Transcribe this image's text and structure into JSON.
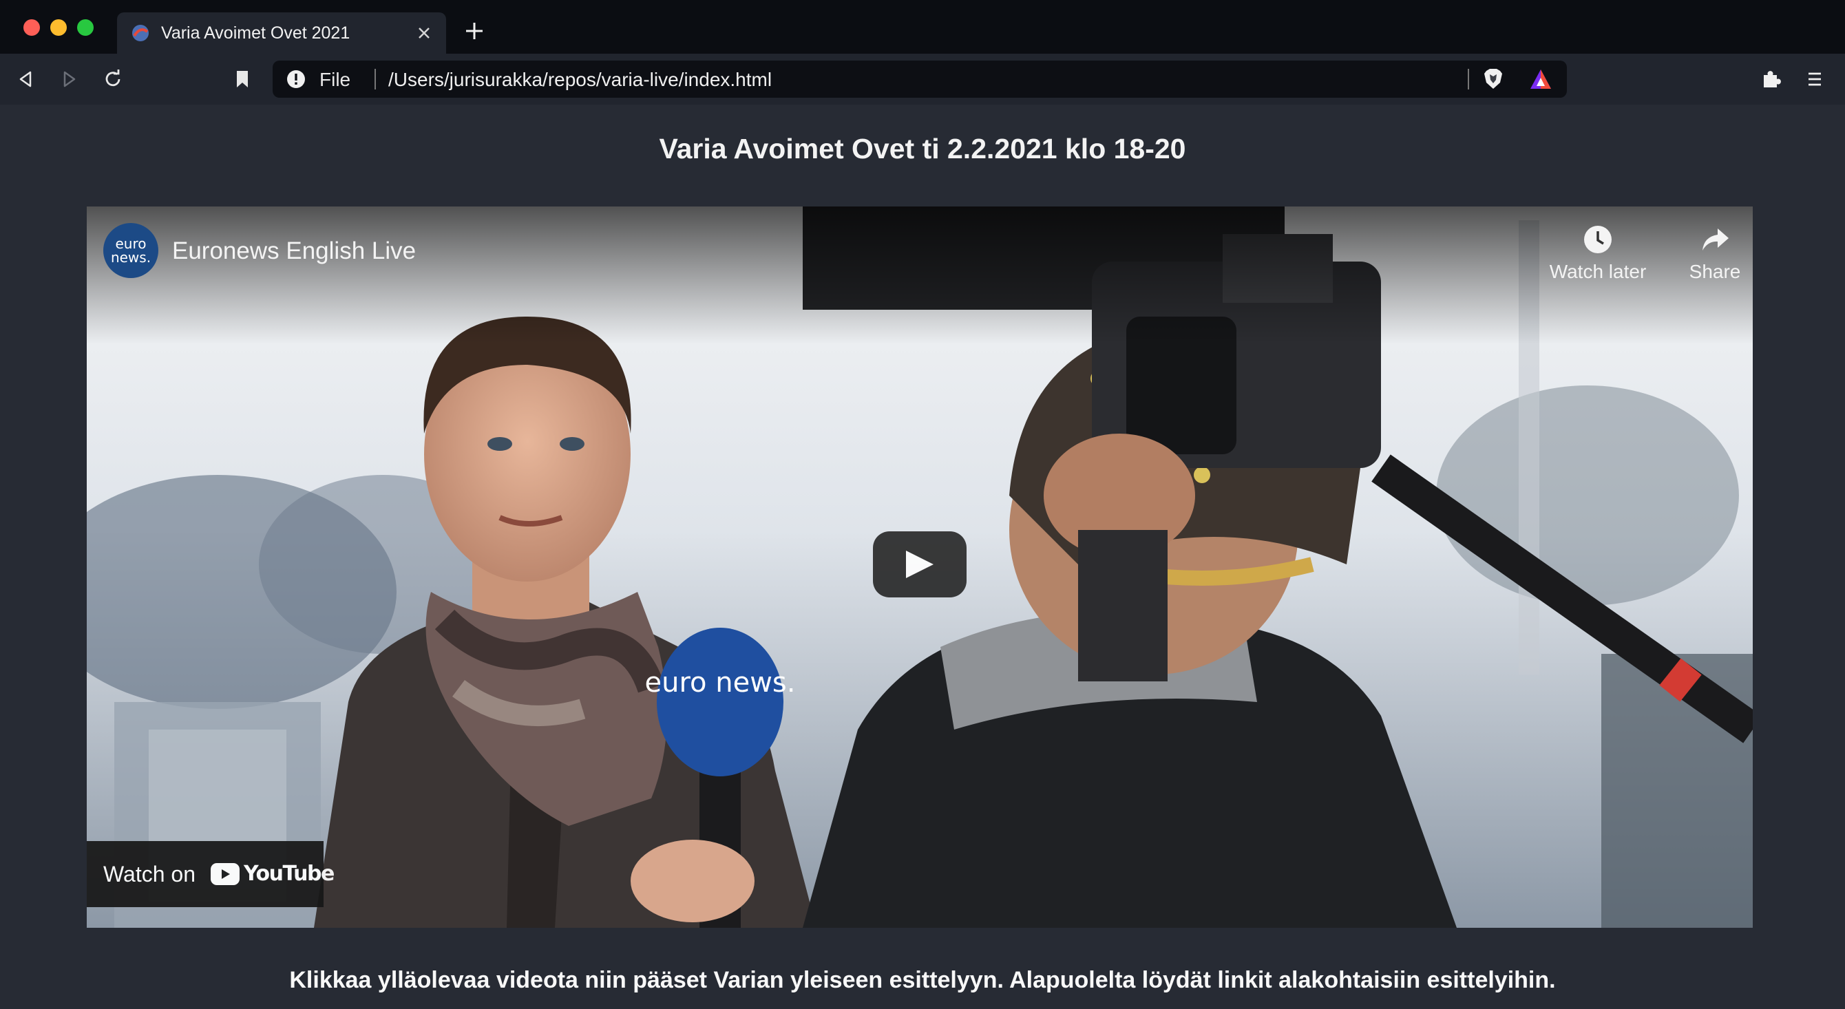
{
  "browser": {
    "tab": {
      "title": "Varia Avoimet Ovet 2021"
    },
    "address": {
      "scheme": "File",
      "path": "/Users/jurisurakka/repos/varia-live/index.html"
    }
  },
  "page": {
    "title": "Varia Avoimet Ovet ti 2.2.2021 klo 18-20",
    "video": {
      "channel_logo_text": "euro news.",
      "channel_name": "Euronews English Live",
      "watch_later_label": "Watch later",
      "share_label": "Share",
      "watch_on_label": "Watch on",
      "youtube_label": "YouTube",
      "microphone_text": "euro news."
    },
    "intro_text": "Klikkaa ylläolevaa videota niin pääset Varian yleiseen esittelyyn. Alapuolelta löydät linkit alakohtaisiin esittelyihin."
  },
  "colors": {
    "background": "#272b34",
    "tab_strip": "#0b0d12",
    "toolbar": "#21252e",
    "euronews_blue": "#1c4a86",
    "youtube_red": "#ff0000"
  }
}
